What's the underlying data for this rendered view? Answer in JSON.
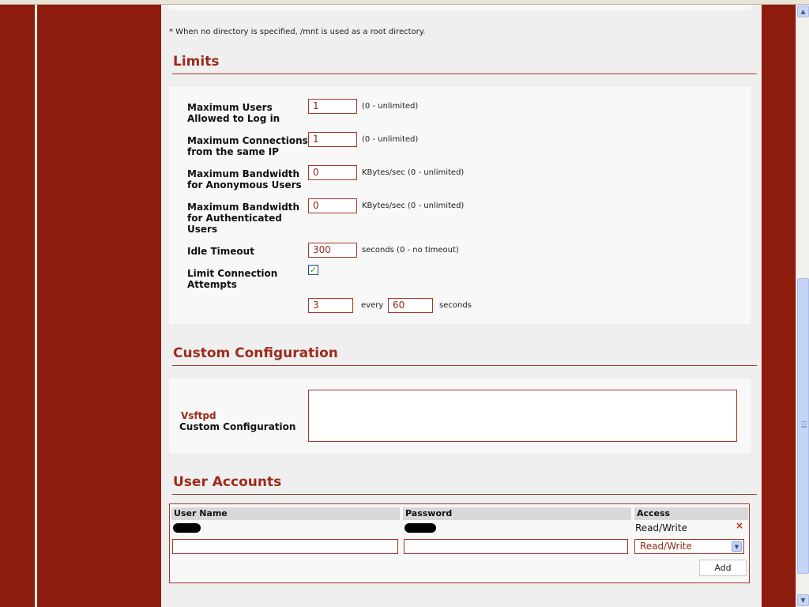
{
  "note_text": "* When no directory is specified, /mnt is used as a root directory.",
  "limits": {
    "title": "Limits",
    "rows": [
      {
        "label1": "Maximum Users",
        "label2": "Allowed to Log in",
        "value": "1",
        "hint": "(0 - unlimited)"
      },
      {
        "label1": "Maximum Connections",
        "label2": "from the same IP",
        "value": "1",
        "hint": "(0 - unlimited)"
      },
      {
        "label1": "Maximum Bandwidth",
        "label2": "for Anonymous Users",
        "value": "0",
        "hint": "KBytes/sec (0 - unlimited)"
      },
      {
        "label1": "Maximum Bandwidth",
        "label2": "for Authenticated",
        "label3": "Users",
        "value": "0",
        "hint": "KBytes/sec (0 - unlimited)"
      },
      {
        "label1": "Idle Timeout",
        "value": "300",
        "hint": "seconds (0 - no timeout)"
      }
    ],
    "limit_attempts": {
      "label1": "Limit Connection",
      "label2": "Attempts",
      "checked": true,
      "attempts_value": "3",
      "every_text": "every",
      "interval_value": "60",
      "seconds_text": "seconds"
    }
  },
  "custom_config": {
    "title": "Custom Configuration",
    "label_top": "Vsftpd",
    "label_bottom": "Custom Configuration",
    "textarea_value": ""
  },
  "accounts": {
    "title": "User Accounts",
    "headers": [
      "User Name",
      "Password",
      "Access"
    ],
    "rows": [
      {
        "access": "Read/Write"
      }
    ],
    "new_row_select_value": "Read/Write",
    "add_label": "Add"
  },
  "icons": {
    "delete": "delete-x-icon",
    "checkbox_mark": "check-icon",
    "select_arrow": "chevron-down-icon",
    "scroll_up": "arrow-up-icon",
    "scroll_down": "arrow-down-icon"
  },
  "colors": {
    "brand_red": "#8e1c0c",
    "section_red": "#9d2b1b",
    "field_border": "#a53525"
  }
}
